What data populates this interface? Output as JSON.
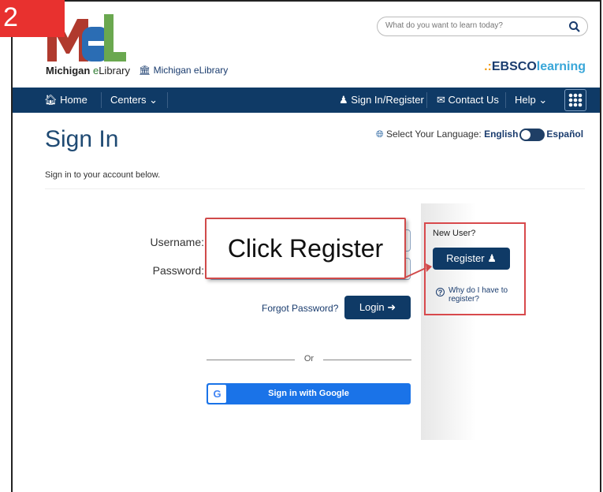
{
  "step_badge": "2",
  "header": {
    "logo_text_bold": "Michigan",
    "logo_text_e": "e",
    "logo_text_rest": "Library",
    "mel_link": "Michigan eLibrary",
    "search_placeholder": "What do you want to learn today?",
    "ebsco_dots": ".:",
    "ebsco_main": "EBSCO",
    "ebsco_learning": "learning"
  },
  "nav": {
    "home": "Home",
    "centers": "Centers",
    "sign_in": "Sign In/Register",
    "contact": "Contact Us",
    "help": "Help"
  },
  "page": {
    "title": "Sign In",
    "language_label": "Select Your Language:",
    "lang_english": "English",
    "lang_spanish": "Español",
    "subtitle": "Sign in to your account below."
  },
  "form": {
    "username_label": "Username:",
    "password_label": "Password:",
    "forgot": "Forgot Password?",
    "login": "Login",
    "or": "Or",
    "google": "Sign in with Google"
  },
  "register": {
    "new_user": "New User?",
    "button": "Register",
    "why_line1": "Why do I have to",
    "why_line2": "register?"
  },
  "callout": "Click Register"
}
